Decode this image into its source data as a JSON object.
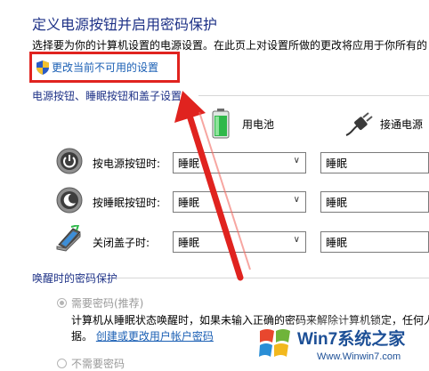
{
  "header": {
    "title": "定义电源按钮并启用密码保护",
    "description": "选择要为你的计算机设置的电源设置。在此页上对设置所做的更改将应用于你所有的",
    "change_link": "更改当前不可用的设置",
    "change_link_icon": "uac-shield-icon"
  },
  "power_section": {
    "title": "电源按钮、睡眠按钮和盖子设置",
    "columns": [
      {
        "label": "用电池",
        "icon": "battery-icon"
      },
      {
        "label": "接通电源",
        "icon": "power-plug-icon"
      }
    ],
    "rows": [
      {
        "label": "按电源按钮时:",
        "icon": "power-button-icon",
        "battery": "睡眠",
        "plugged": "睡眠"
      },
      {
        "label": "按睡眠按钮时:",
        "icon": "sleep-button-icon",
        "battery": "睡眠",
        "plugged": "睡眠"
      },
      {
        "label": "关闭盖子时:",
        "icon": "laptop-lid-icon",
        "battery": "睡眠",
        "plugged": "睡眠"
      }
    ]
  },
  "wake_section": {
    "title": "唤醒时的密码保护",
    "require_password": {
      "label": "需要密码(推荐)",
      "selected": true,
      "description_line1": "计算机从睡眠状态唤醒时，如果未输入正确的密码来解除计算机锁定，任何人",
      "description_line2_prefix": "据。",
      "link": "创建或更改用户帐户密码"
    },
    "no_password": {
      "label": "不需要密码",
      "selected": false
    }
  },
  "watermark": {
    "brand": "Win7系统之家",
    "url": "Www.Winwin7.com"
  },
  "colors": {
    "heading": "#1e3287",
    "link": "#1a5fb4",
    "highlight": "#e0231f",
    "disabled_text": "#9a9a9a"
  }
}
